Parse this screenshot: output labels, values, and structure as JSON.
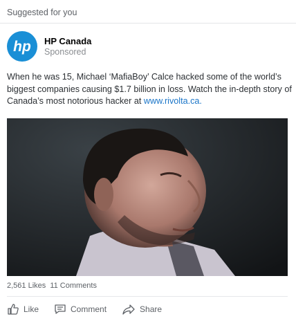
{
  "header": {
    "suggested_label": "Suggested for you"
  },
  "advertiser": {
    "name": "HP Canada",
    "status": "Sponsored",
    "logo_text": "hp",
    "brand_color": "#1a8fd6"
  },
  "post": {
    "text": "When he was 15, Michael ‘MafiaBoy’ Calce hacked some of the world’s biggest companies causing $1.7 billion in loss. Watch the in-depth story of Canada’s most notorious hacker at ",
    "link_text": "www.rivolta.ca.",
    "link_color": "#1a75c8"
  },
  "stats": {
    "likes": "2,561 Likes",
    "comments": "11 Comments"
  },
  "actions": {
    "like": {
      "label": "Like",
      "icon": "thumbs-up-icon"
    },
    "comment": {
      "label": "Comment",
      "icon": "speech-bubble-icon"
    },
    "share": {
      "label": "Share",
      "icon": "share-arrow-icon"
    }
  }
}
